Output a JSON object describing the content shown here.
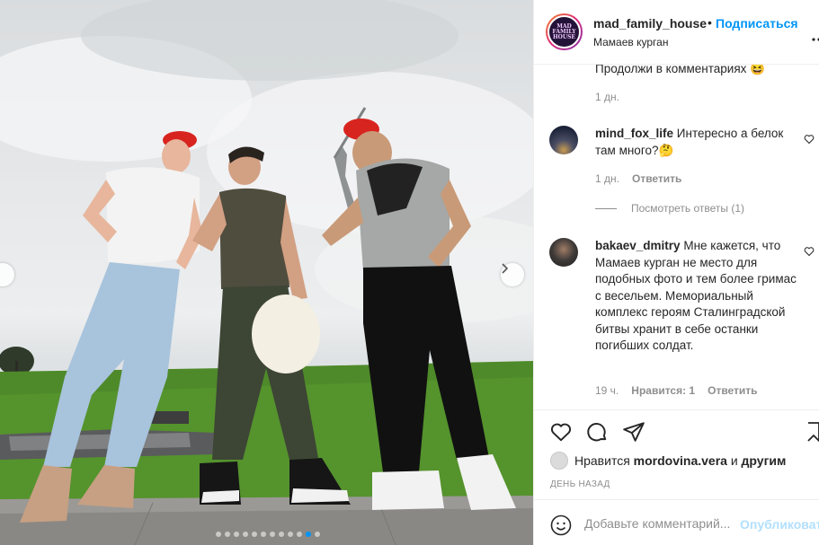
{
  "post": {
    "username": "mad_family_house",
    "separator": "•",
    "follow_label": "Подписаться",
    "location": "Мамаев курган",
    "avatar_text": "MAD FAMILY HOUSE"
  },
  "comments": [
    {
      "text": "Продолжи в комментариях 😆",
      "time": "1 дн."
    },
    {
      "username": "mind_fox_life",
      "text": "Интересно а белок там много?🤔",
      "time": "1 дн.",
      "reply_label": "Ответить",
      "view_replies": "Посмотреть ответы (1)"
    },
    {
      "username": "bakaev_dmitry",
      "text": "Мне кажется, что Мамаев курган не место для подобных фото и тем более гримас с весельем. Мемориальный комплекс героям Сталинградской битвы хранит в себе останки погибших солдат.",
      "time": "19 ч.",
      "likes_label": "Нравится: 1",
      "reply_label": "Ответить"
    }
  ],
  "likes": {
    "prefix": "Нравится",
    "user": "mordovina.vera",
    "conj": "и",
    "others": "другим"
  },
  "date_label": "ДЕНЬ НАЗАД",
  "comment_box": {
    "placeholder": "Добавьте комментарий...",
    "publish_label": "Опубликовать"
  },
  "carousel": {
    "count": 12,
    "active_index": 10
  },
  "icons": [
    "chevron-left-icon",
    "chevron-right-icon",
    "heart-icon",
    "comment-icon",
    "share-icon",
    "bookmark-icon",
    "emoji-icon",
    "more-icon"
  ],
  "colors": {
    "accent": "#0095f6",
    "publish_disabled": "#b2dffc",
    "meta": "#8e8e8e",
    "text": "#262626"
  }
}
